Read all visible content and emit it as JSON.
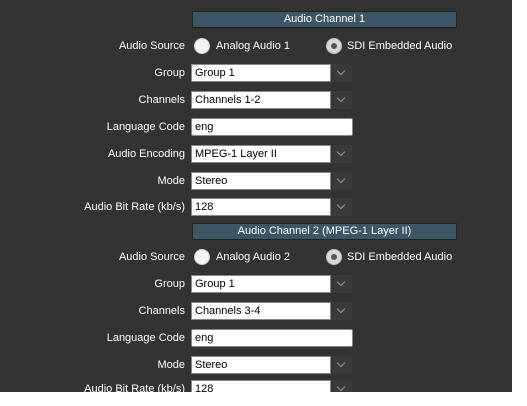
{
  "channels": [
    {
      "header": "Audio Channel 1",
      "rows": {
        "audio_source": {
          "label": "Audio Source",
          "options": [
            "Analog Audio 1",
            "SDI Embedded Audio"
          ],
          "selected": "SDI Embedded Audio"
        },
        "group": {
          "label": "Group",
          "value": "Group 1"
        },
        "channels": {
          "label": "Channels",
          "value": "Channels 1-2"
        },
        "language_code": {
          "label": "Language Code",
          "value": "eng"
        },
        "audio_encoding": {
          "label": "Audio Encoding",
          "value": "MPEG-1 Layer II"
        },
        "mode": {
          "label": "Mode",
          "value": "Stereo"
        },
        "bit_rate": {
          "label": "Audio Bit Rate (kb/s)",
          "value": "128"
        }
      }
    },
    {
      "header": "Audio Channel 2 (MPEG-1 Layer II)",
      "rows": {
        "audio_source": {
          "label": "Audio Source",
          "options": [
            "Analog Audio 2",
            "SDI Embedded Audio"
          ],
          "selected": "SDI Embedded Audio"
        },
        "group": {
          "label": "Group",
          "value": "Group 1"
        },
        "channels": {
          "label": "Channels",
          "value": "Channels 3-4"
        },
        "language_code": {
          "label": "Language Code",
          "value": "eng"
        },
        "mode": {
          "label": "Mode",
          "value": "Stereo"
        },
        "bit_rate": {
          "label": "Audio Bit Rate (kb/s)",
          "value": "128"
        }
      }
    }
  ],
  "icons": {
    "dropdown": "chevron-down-icon",
    "radio": "radio-button-icon"
  },
  "colors": {
    "panel_bg": "#333333",
    "header_bg": "#3c5665",
    "text": "#ffffff"
  }
}
